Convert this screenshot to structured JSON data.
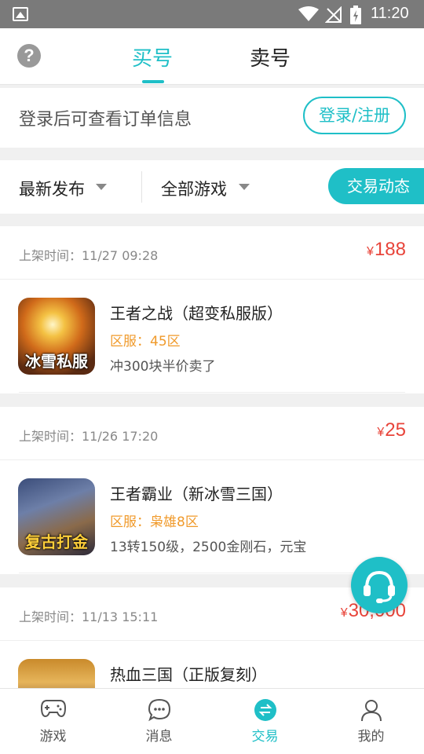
{
  "status_bar": {
    "time": "11:20"
  },
  "header": {
    "help_icon": "?",
    "tabs": [
      {
        "label": "买号",
        "active": true
      },
      {
        "label": "卖号",
        "active": false
      }
    ]
  },
  "login_bar": {
    "text": "登录后可查看订单信息",
    "button_label": "登录/注册"
  },
  "filters": {
    "sort_label": "最新发布",
    "game_label": "全部游戏",
    "trade_dynamic_label": "交易动态"
  },
  "listings": [
    {
      "time_label": "上架时间：11/27 09:28",
      "currency": "¥",
      "price": "188",
      "thumb_label": "冰雪私服",
      "title": "王者之战（超变私服版）",
      "server": "区服：45区",
      "desc": "冲300块半价卖了"
    },
    {
      "time_label": "上架时间：11/26 17:20",
      "currency": "¥",
      "price": "25",
      "thumb_label": "复古打金",
      "title": "王者霸业（新冰雪三国）",
      "server": "区服：枭雄8区",
      "desc": "13转150级，2500金刚石，元宝"
    },
    {
      "time_label": "上架时间：11/13 15:11",
      "currency": "¥",
      "price": "30,000",
      "thumb_label": "",
      "title": "热血三国（正版复刻）",
      "server": "",
      "desc": ""
    }
  ],
  "bottom_nav": [
    {
      "label": "游戏",
      "icon": "gamepad-icon",
      "active": false
    },
    {
      "label": "消息",
      "icon": "chat-icon",
      "active": false
    },
    {
      "label": "交易",
      "icon": "exchange-icon",
      "active": true
    },
    {
      "label": "我的",
      "icon": "person-icon",
      "active": false
    }
  ],
  "colors": {
    "accent": "#1fbfc7",
    "price": "#e8443a",
    "server": "#f09a2b"
  }
}
